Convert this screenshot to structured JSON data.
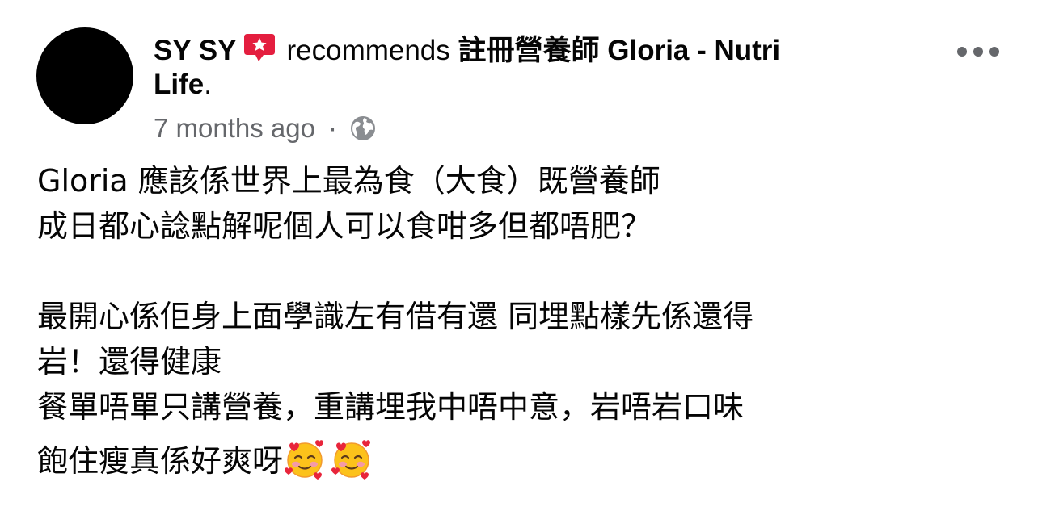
{
  "post": {
    "author": "SY SY",
    "verb": "recommends",
    "page_name_part1": "註冊營養師 Gloria - Nutri",
    "page_name_part2": "Life",
    "period": ".",
    "timestamp": "7 months ago",
    "separator": "·",
    "audience_icon": "globe-icon",
    "badge_icon": "recommendation-star-icon",
    "more_icon": "more-options-icon",
    "body_lines": [
      "Gloria 應該係世界上最為食（大食）既營養師",
      "成日都心諗點解呢個人可以食咁多但都唔肥？",
      "",
      "最開心係佢身上面學識左有借有還 同埋點樣先係還得",
      "岩！還得健康",
      "餐單唔單只講營養，重講埋我中唔中意，岩唔岩口味",
      "飽住瘦真係好爽呀"
    ],
    "emoji": [
      "smiling-face-with-hearts-icon",
      "smiling-face-with-hearts-icon"
    ]
  },
  "colors": {
    "text": "#050505",
    "secondary_text": "#65676b",
    "badge": "#e41e3f",
    "avatar": "#000000"
  }
}
